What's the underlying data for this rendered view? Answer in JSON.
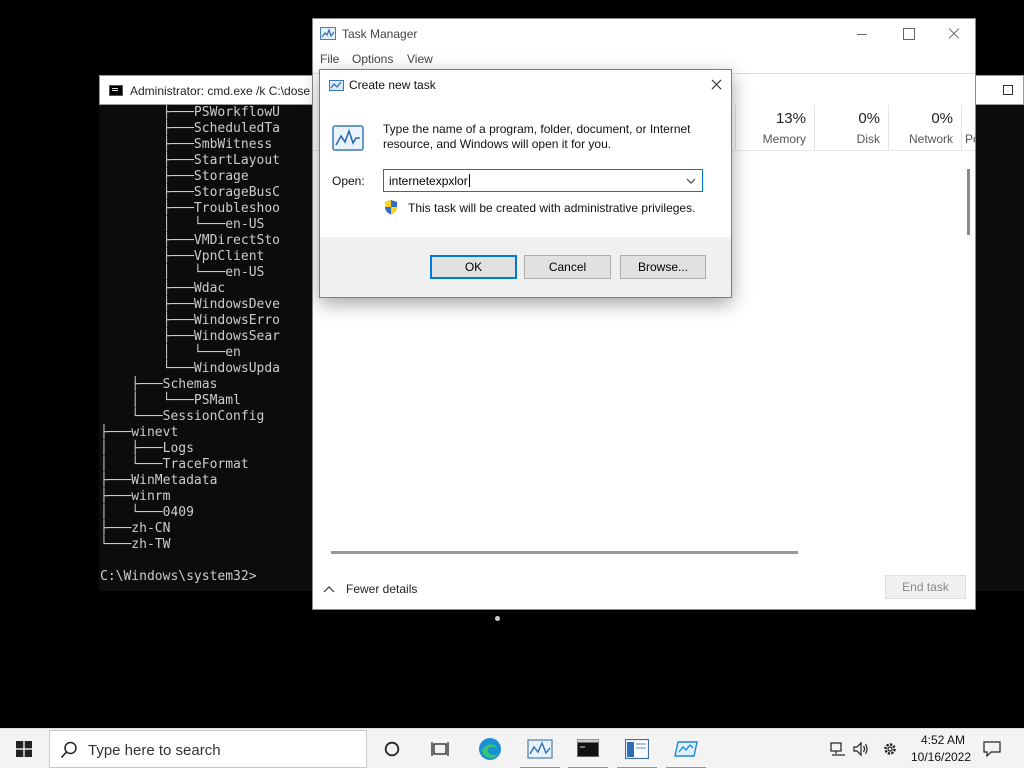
{
  "cmd": {
    "title": "Administrator: cmd.exe /k C:\\dose",
    "lines": [
      "        ├───PSWorkflowU",
      "        ├───ScheduledTa",
      "        ├───SmbWitness",
      "        ├───StartLayout",
      "        ├───Storage",
      "        ├───StorageBusC",
      "        ├───Troubleshoo",
      "        │   └───en-US",
      "        ├───VMDirectSto",
      "        ├───VpnClient",
      "        │   └───en-US",
      "        ├───Wdac",
      "        ├───WindowsDeve",
      "        ├───WindowsErro",
      "        ├───WindowsSear",
      "        │   └───en",
      "        └───WindowsUpda",
      "    ├───Schemas",
      "    │   └───PSMaml",
      "    └───SessionConfig",
      "├───winevt",
      "│   ├───Logs",
      "│   └───TraceFormat",
      "├───WinMetadata",
      "├───winrm",
      "│   └───0409",
      "├───zh-CN",
      "└───zh-TW",
      "",
      "C:\\Windows\\system32>"
    ]
  },
  "task_manager": {
    "title": "Task Manager",
    "menu": [
      "File",
      "Options",
      "View"
    ],
    "columns": [
      {
        "pct": "",
        "label": ""
      },
      {
        "pct": "13%",
        "label": "Memory"
      },
      {
        "pct": "0%",
        "label": "Disk"
      },
      {
        "pct": "0%",
        "label": "Network"
      },
      {
        "pct": "",
        "label": "Po"
      }
    ],
    "fewer_details": "Fewer details",
    "end_task": "End task"
  },
  "run_dialog": {
    "title": "Create new task",
    "description": "Type the name of a program, folder, document, or Internet resource, and Windows will open it for you.",
    "open_label": "Open:",
    "input_value": "internetexpxlor",
    "admin_note": "This task will be created with administrative privileges.",
    "ok": "OK",
    "cancel": "Cancel",
    "browse": "Browse..."
  },
  "taskbar": {
    "search_placeholder": "Type here to search",
    "apps": [
      "task-view-icon",
      "edge-icon",
      "task-manager-icon",
      "cmd-icon",
      "explorer-window-icon",
      "run-icon"
    ],
    "time": "4:52 AM",
    "date": "10/16/2022"
  },
  "colors": {
    "accent": "#0078d7",
    "cmd_background": "#0c0c0c",
    "cmd_text": "#cccccc",
    "taskbar": "#f3f3f3"
  }
}
